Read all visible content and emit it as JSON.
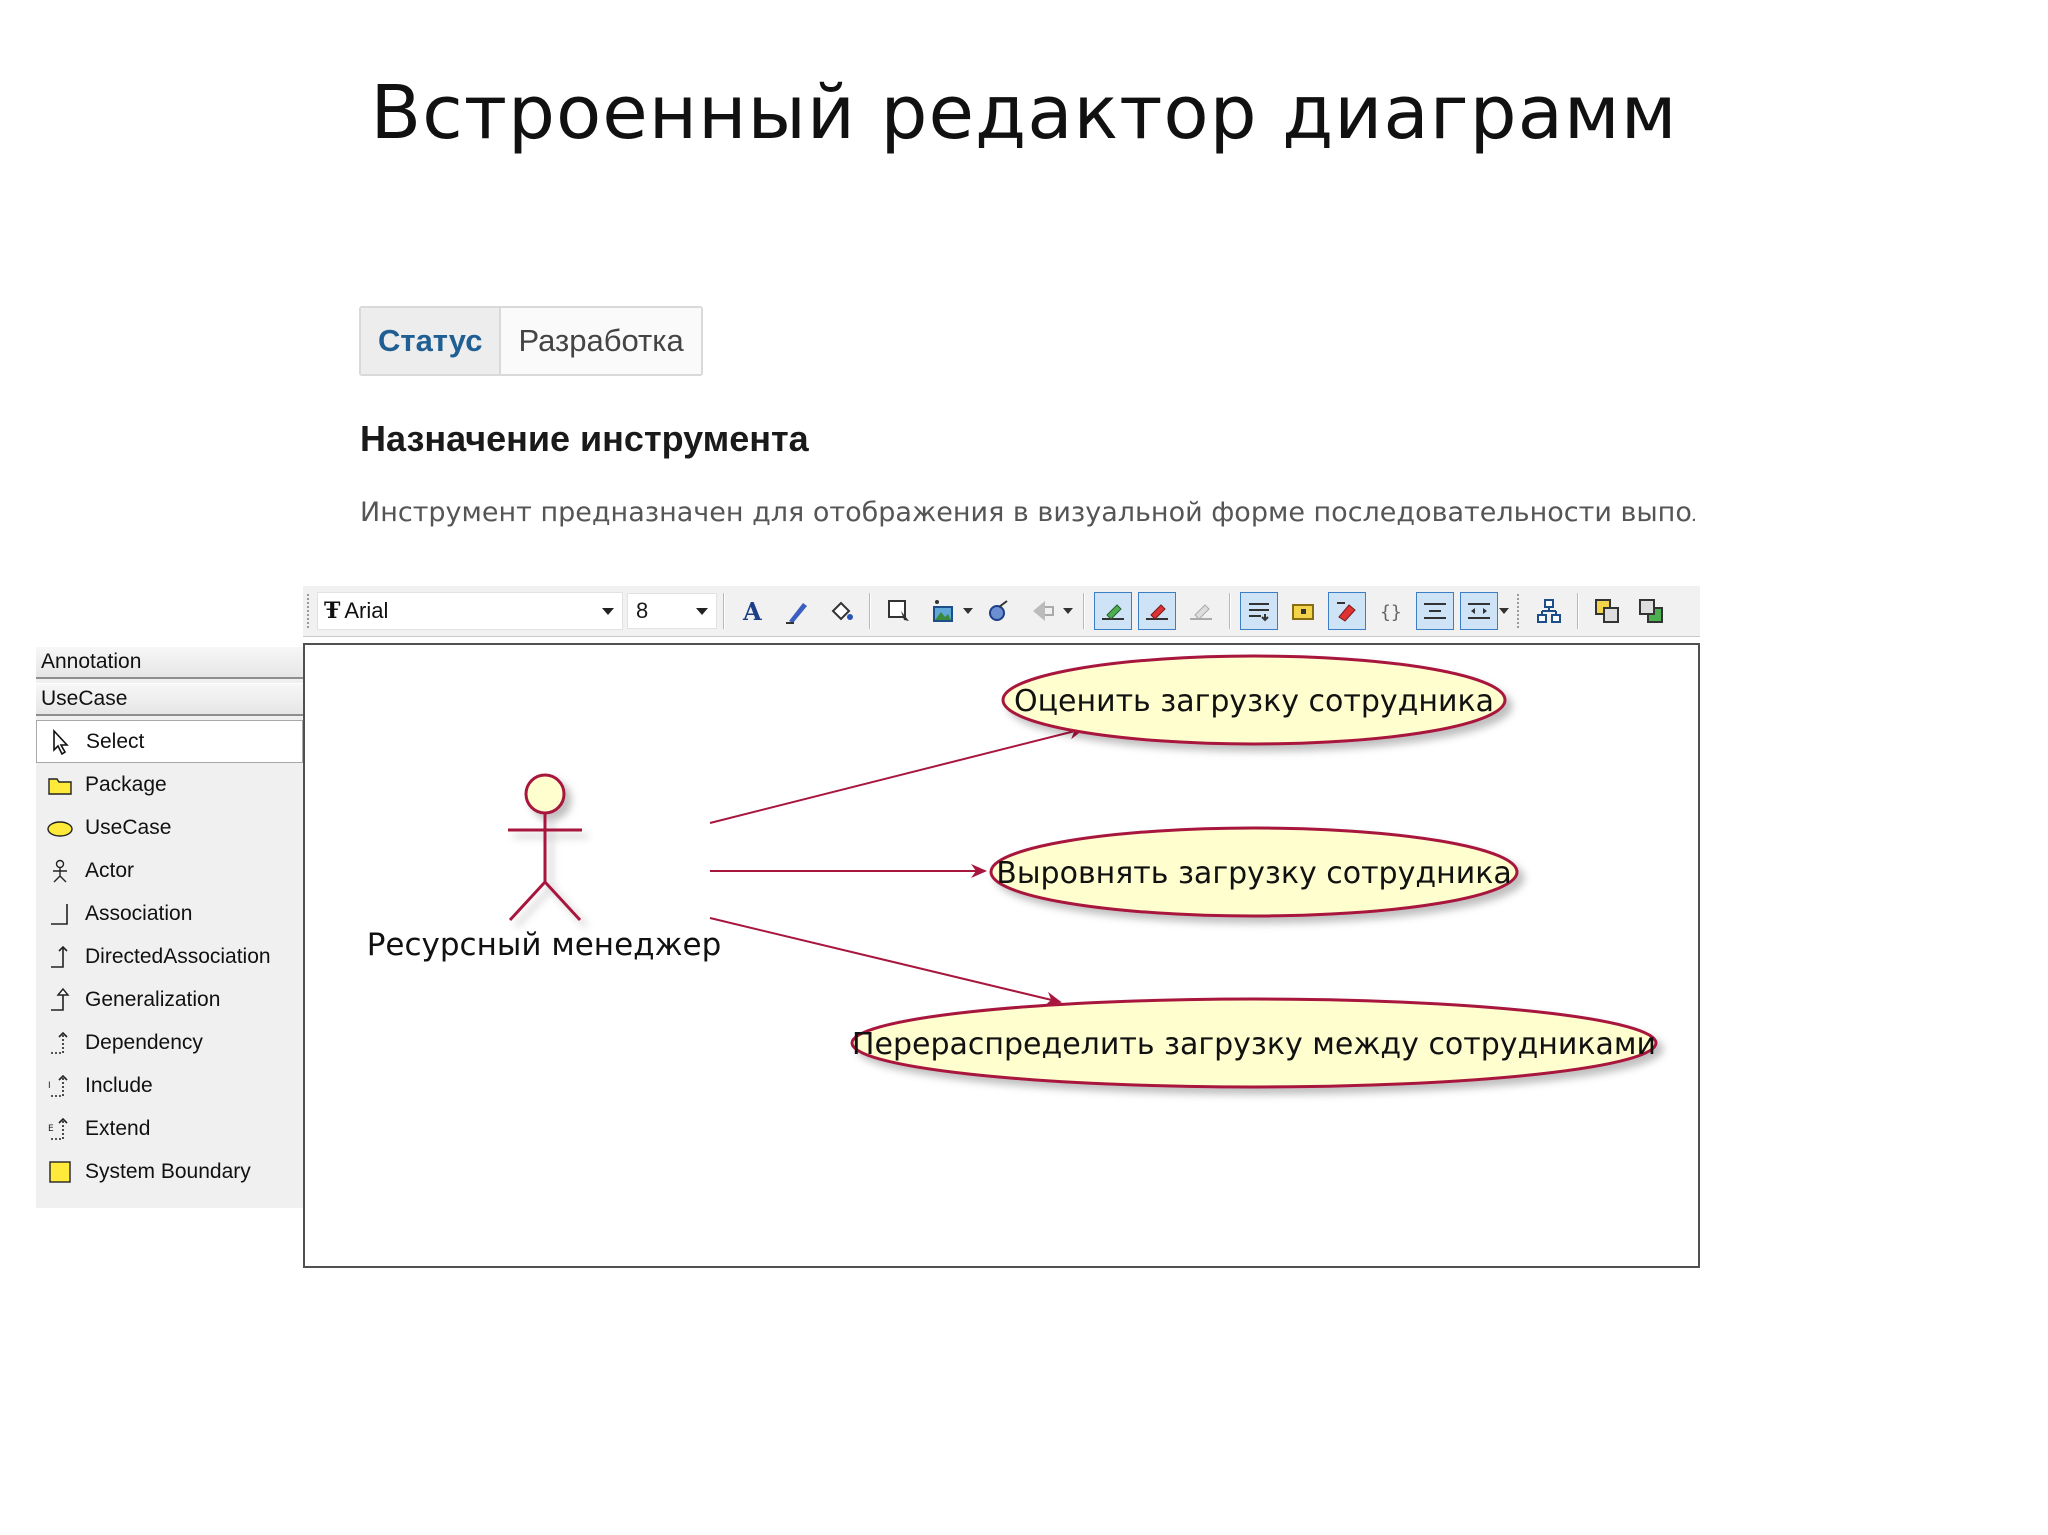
{
  "slide": {
    "title": "Встроенный редактор диаграмм"
  },
  "tabs": [
    {
      "label": "Статус",
      "active": true
    },
    {
      "label": "Разработка",
      "active": false
    }
  ],
  "section": {
    "heading": "Назначение инструмента",
    "description": "Инструмент предназначен для отображения в визуальной форме последовательности выполне"
  },
  "toolbar": {
    "font_family": "Arial",
    "font_size": "8",
    "buttons": [
      "font-color-icon",
      "pen-color-icon",
      "fill-color-icon",
      "select-shape-icon",
      "insert-image-icon",
      "shape-style-icon",
      "arrow-style-icon",
      "snap-grid-icon",
      "delete-grid-icon",
      "disabled-grid-icon",
      "wrap-text-icon",
      "folder-icon",
      "edit-shape-icon",
      "braces-icon",
      "align-center-icon",
      "align-split-icon",
      "layout-icon",
      "bring-front-icon",
      "send-back-icon"
    ]
  },
  "palette": {
    "groups": [
      "Annotation",
      "UseCase"
    ],
    "items": [
      {
        "label": "Select",
        "icon": "cursor-icon",
        "selected": true
      },
      {
        "label": "Package",
        "icon": "package-icon",
        "selected": false
      },
      {
        "label": "UseCase",
        "icon": "usecase-icon",
        "selected": false
      },
      {
        "label": "Actor",
        "icon": "actor-icon",
        "selected": false
      },
      {
        "label": "Association",
        "icon": "association-icon",
        "selected": false
      },
      {
        "label": "DirectedAssociation",
        "icon": "directed-association-icon",
        "selected": false
      },
      {
        "label": "Generalization",
        "icon": "generalization-icon",
        "selected": false
      },
      {
        "label": "Dependency",
        "icon": "dependency-icon",
        "selected": false
      },
      {
        "label": "Include",
        "icon": "include-icon",
        "selected": false
      },
      {
        "label": "Extend",
        "icon": "extend-icon",
        "selected": false
      },
      {
        "label": "System Boundary",
        "icon": "system-boundary-icon",
        "selected": false
      }
    ]
  },
  "diagram": {
    "actor": {
      "label": "Ресурсный менеджер"
    },
    "use_cases": [
      {
        "label": "Оценить загрузку сотрудника"
      },
      {
        "label": "Выровнять загрузку сотрудника"
      },
      {
        "label": "Перераспределить загрузку между сотрудниками"
      }
    ],
    "colors": {
      "line": "#a8163e",
      "usecase_fill": "#fefece",
      "usecase_stroke": "#a8163e"
    }
  }
}
